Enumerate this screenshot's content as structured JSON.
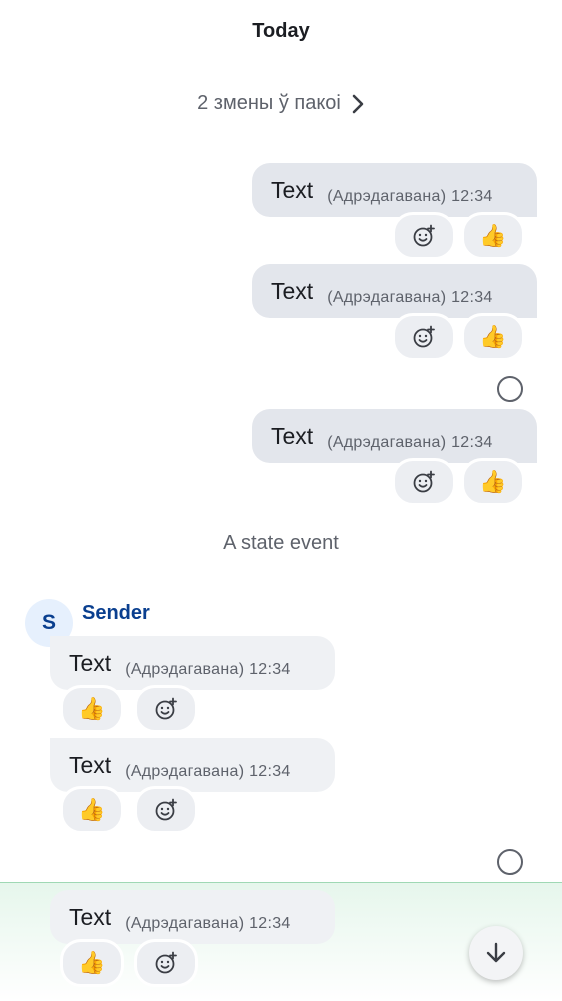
{
  "timeline": {
    "day_header": "Today",
    "changes_summary": "2 змены ў пакоі",
    "state_event": "A state event",
    "sender": {
      "initial": "S",
      "name": "Sender"
    },
    "outgoing_messages": [
      {
        "text": "Text",
        "meta": "(Адрэдагавана) 12:34",
        "reactions": [
          "add-reaction",
          "👍"
        ]
      },
      {
        "text": "Text",
        "meta": "(Адрэдагавана) 12:34",
        "reactions": [
          "add-reaction",
          "👍"
        ]
      },
      {
        "text": "Text",
        "meta": "(Адрэдагавана) 12:34",
        "reactions": [
          "add-reaction",
          "👍"
        ]
      }
    ],
    "incoming_messages": [
      {
        "text": "Text",
        "meta": "(Адрэдагавана) 12:34",
        "reactions": [
          "👍",
          "add-reaction"
        ]
      },
      {
        "text": "Text",
        "meta": "(Адрэдагавана) 12:34",
        "reactions": [
          "👍",
          "add-reaction"
        ]
      },
      {
        "text": "Text",
        "meta": "(Адрэдагавана) 12:34",
        "reactions": [
          "👍",
          "add-reaction"
        ]
      }
    ],
    "thumbs_emoji": "👍"
  },
  "colors": {
    "bubble_outgoing": "#e3e6ec",
    "bubble_incoming": "#eff1f4",
    "sender_name": "#0a3f8f",
    "highlight": "#e6f6ec"
  },
  "icons": {
    "add_reaction": "add-reaction-icon",
    "chevron": "chevron-right-icon",
    "read_receipt": "read-receipt-icon",
    "scroll_down": "arrow-down-icon"
  }
}
